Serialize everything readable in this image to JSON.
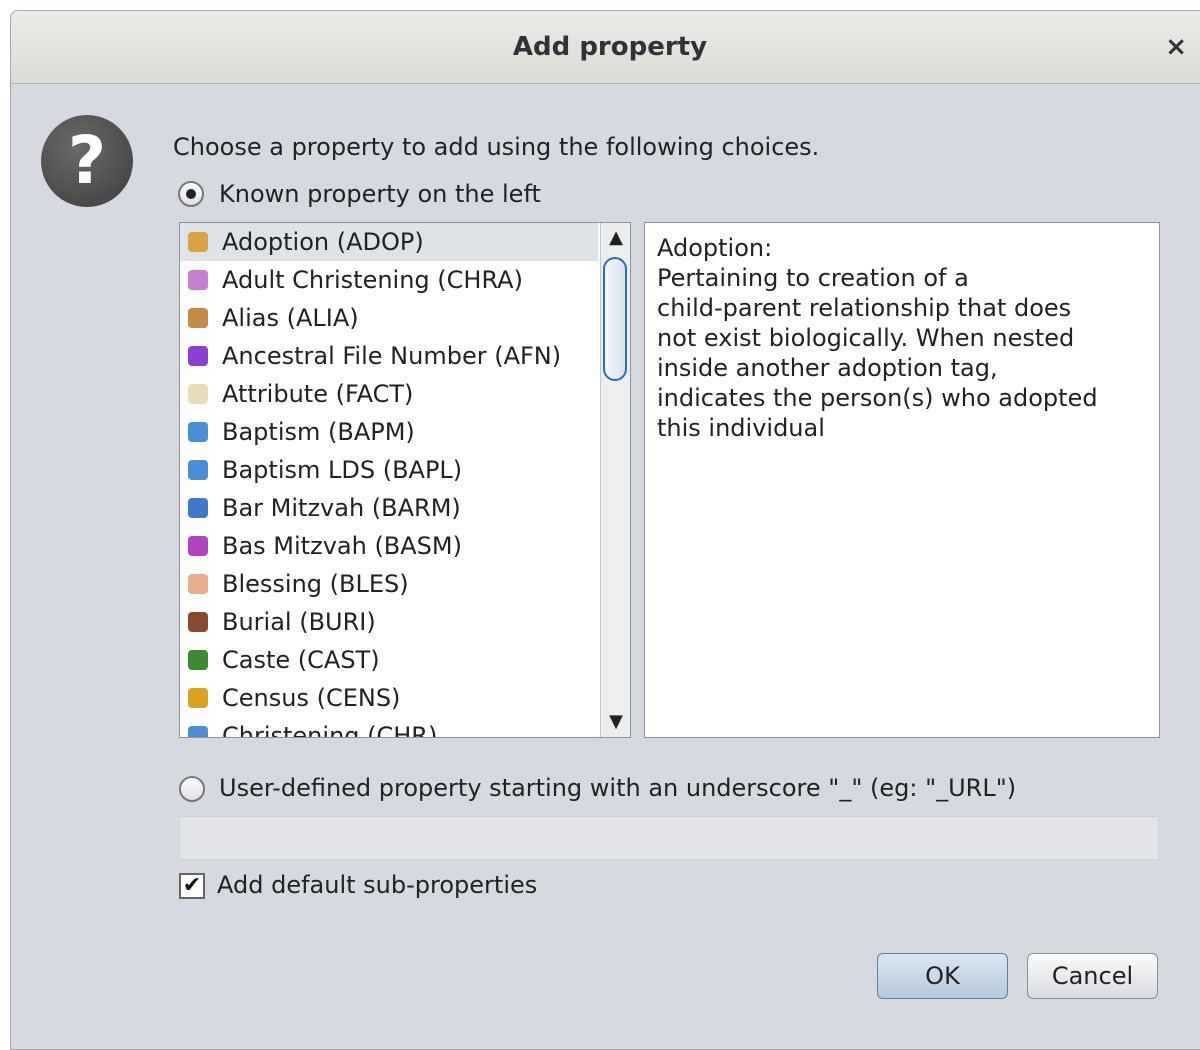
{
  "dialog": {
    "title": "Add property",
    "close_glyph": "×",
    "question_icon_glyph": "?",
    "prompt": "Choose a property to add using the following choices."
  },
  "known_option": {
    "label": "Known property on the left",
    "selected": true
  },
  "property_list": {
    "selected_index": 0,
    "items": [
      {
        "label": "Adoption (ADOP)",
        "icon": "adoption-icon",
        "color": "#d9a441"
      },
      {
        "label": "Adult Christening (CHRA)",
        "icon": "adult-christening-icon",
        "color": "#c97fd1"
      },
      {
        "label": "Alias (ALIA)",
        "icon": "alias-icon",
        "color": "#c38a4a"
      },
      {
        "label": "Ancestral File Number (AFN)",
        "icon": "puzzle-icon",
        "color": "#8e3fd0"
      },
      {
        "label": "Attribute (FACT)",
        "icon": "document-icon",
        "color": "#e9dcb8"
      },
      {
        "label": "Baptism (BAPM)",
        "icon": "baptism-icon",
        "color": "#4a8fd6"
      },
      {
        "label": "Baptism LDS (BAPL)",
        "icon": "baptism-lds-icon",
        "color": "#4a8fd6"
      },
      {
        "label": "Bar Mitzvah (BARM)",
        "icon": "star-of-david-blue-icon",
        "color": "#3f79c8"
      },
      {
        "label": "Bas Mitzvah (BASM)",
        "icon": "star-of-david-purple-icon",
        "color": "#b344c0"
      },
      {
        "label": "Blessing (BLES)",
        "icon": "hand-icon",
        "color": "#e8b08a"
      },
      {
        "label": "Burial (BURI)",
        "icon": "coffin-icon",
        "color": "#8a4a2f"
      },
      {
        "label": "Caste (CAST)",
        "icon": "caste-icon",
        "color": "#3c8a32"
      },
      {
        "label": "Census (CENS)",
        "icon": "census-icon",
        "color": "#d9a520"
      },
      {
        "label": "Christening (CHR)",
        "icon": "christening-icon",
        "color": "#4a8fd6"
      }
    ]
  },
  "description": {
    "title": "Adoption:",
    "body": "Pertaining to creation of a\nchild-parent relationship that does\nnot exist biologically. When nested\ninside another adoption tag,\nindicates the person(s) who adopted\nthis individual"
  },
  "user_option": {
    "label": "User-defined property starting with an underscore \"_\" (eg: \"_URL\")",
    "selected": false,
    "value": ""
  },
  "sub_properties": {
    "label": "Add default sub-properties",
    "checked": true,
    "check_glyph": "✔"
  },
  "scrollbar": {
    "up_glyph": "▲",
    "down_glyph": "▼"
  },
  "buttons": {
    "ok": "OK",
    "cancel": "Cancel"
  }
}
